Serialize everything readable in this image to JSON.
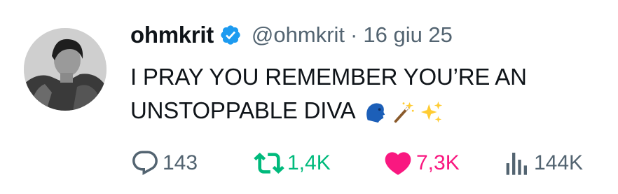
{
  "tweet": {
    "author_name": "ohmkrit",
    "handle": "@ohmkrit",
    "separator": "·",
    "date": "16 giu 25",
    "text_line1": "I PRAY YOU REMEMBER YOU’RE AN",
    "text_line2": "UNSTOPPABLE DIVA",
    "emojis": [
      "speaking-head-emoji",
      "magic-wand-emoji",
      "sparkles-emoji"
    ]
  },
  "actions": {
    "replies": "143",
    "retweets": "1,4K",
    "likes": "7,3K",
    "views": "144K"
  },
  "colors": {
    "verified": "#1d9bf0",
    "retweet_active": "#00ba7c",
    "like_active": "#f91880",
    "secondary_text": "#536471"
  },
  "icons": [
    "verified-badge-icon",
    "reply-icon",
    "retweet-icon",
    "like-icon",
    "views-icon"
  ]
}
